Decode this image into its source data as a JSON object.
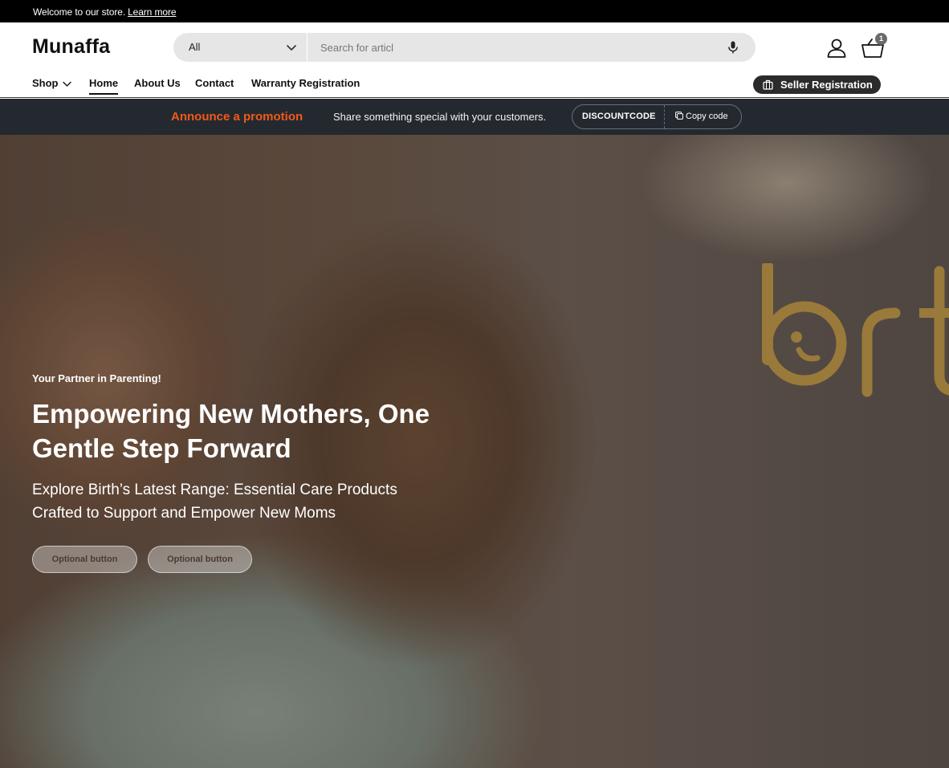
{
  "topbar": {
    "message": "Welcome to our store.",
    "link_label": "Learn more"
  },
  "header": {
    "logo": "Munaffa",
    "search": {
      "category_value": "All",
      "input_value": "",
      "placeholder": "Search for articl"
    },
    "cart_count": "1",
    "nav": {
      "items": [
        "Shop",
        "Home",
        "About Us",
        "Contact",
        "Warranty Registration"
      ],
      "active": "Home"
    },
    "seller_button_label": "Seller Registration",
    "icons": [
      "chevron-down-icon",
      "microphone-icon",
      "account-icon",
      "cart-icon",
      "briefcase-icon"
    ]
  },
  "promo": {
    "heading": "Announce a promotion",
    "text": "Share something special with your customers.",
    "code": "DISCOUNTCODE",
    "copy_label": "Copy code",
    "heading_color": "#f2591a"
  },
  "hero": {
    "kicker": "Your Partner in Parenting!",
    "headline": "Empowering New Mothers, One Gentle Step Forward",
    "subhead": "Explore Birth’s Latest Range: Essential Care Products Crafted to Support and Empower New Moms",
    "buttons": [
      "Optional button",
      "Optional button"
    ],
    "brand_mark_text": "birt",
    "brand_color": "#9a7a3a"
  }
}
